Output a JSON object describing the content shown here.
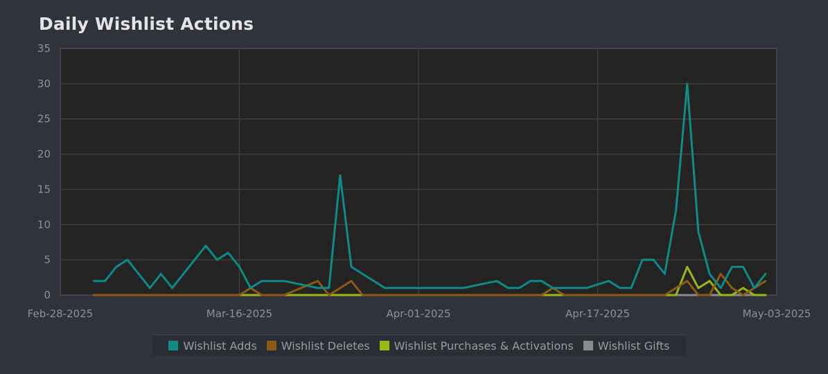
{
  "chart_data": {
    "type": "line",
    "title": "Daily Wishlist Actions",
    "xlabel": "",
    "ylabel": "",
    "ylim": [
      0,
      35
    ],
    "yticks": [
      0,
      5,
      10,
      15,
      20,
      25,
      30,
      35
    ],
    "xlim": [
      "2025-02-28",
      "2025-05-03"
    ],
    "xticks": [
      "Feb-28-2025",
      "Mar-16-2025",
      "Apr-01-2025",
      "Apr-17-2025",
      "May-03-2025"
    ],
    "grid": true,
    "legend_position": "bottom",
    "series": [
      {
        "name": "Wishlist Adds",
        "color": "#0e8a87",
        "points": [
          [
            "2025-03-03",
            2
          ],
          [
            "2025-03-04",
            2
          ],
          [
            "2025-03-05",
            4
          ],
          [
            "2025-03-06",
            5
          ],
          [
            "2025-03-08",
            1
          ],
          [
            "2025-03-09",
            3
          ],
          [
            "2025-03-10",
            1
          ],
          [
            "2025-03-13",
            7
          ],
          [
            "2025-03-14",
            5
          ],
          [
            "2025-03-15",
            6
          ],
          [
            "2025-03-16",
            4
          ],
          [
            "2025-03-17",
            1
          ],
          [
            "2025-03-18",
            2
          ],
          [
            "2025-03-20",
            2
          ],
          [
            "2025-03-23",
            1
          ],
          [
            "2025-03-24",
            1
          ],
          [
            "2025-03-25",
            17
          ],
          [
            "2025-03-26",
            4
          ],
          [
            "2025-03-29",
            1
          ],
          [
            "2025-04-02",
            1
          ],
          [
            "2025-04-05",
            1
          ],
          [
            "2025-04-08",
            2
          ],
          [
            "2025-04-09",
            1
          ],
          [
            "2025-04-10",
            1
          ],
          [
            "2025-04-11",
            2
          ],
          [
            "2025-04-12",
            2
          ],
          [
            "2025-04-13",
            1
          ],
          [
            "2025-04-16",
            1
          ],
          [
            "2025-04-18",
            2
          ],
          [
            "2025-04-19",
            1
          ],
          [
            "2025-04-20",
            1
          ],
          [
            "2025-04-21",
            5
          ],
          [
            "2025-04-22",
            5
          ],
          [
            "2025-04-23",
            3
          ],
          [
            "2025-04-24",
            12
          ],
          [
            "2025-04-25",
            30
          ],
          [
            "2025-04-26",
            9
          ],
          [
            "2025-04-27",
            3
          ],
          [
            "2025-04-28",
            1
          ],
          [
            "2025-04-29",
            4
          ],
          [
            "2025-04-30",
            4
          ],
          [
            "2025-05-01",
            1
          ],
          [
            "2025-05-02",
            3
          ]
        ]
      },
      {
        "name": "Wishlist Deletes",
        "color": "#8c5a12",
        "points": [
          [
            "2025-03-03",
            0
          ],
          [
            "2025-03-16",
            0
          ],
          [
            "2025-03-17",
            1
          ],
          [
            "2025-03-18",
            0
          ],
          [
            "2025-03-20",
            0
          ],
          [
            "2025-03-23",
            2
          ],
          [
            "2025-03-24",
            0
          ],
          [
            "2025-03-26",
            2
          ],
          [
            "2025-03-27",
            0
          ],
          [
            "2025-04-12",
            0
          ],
          [
            "2025-04-13",
            1
          ],
          [
            "2025-04-14",
            0
          ],
          [
            "2025-04-23",
            0
          ],
          [
            "2025-04-25",
            2
          ],
          [
            "2025-04-26",
            0
          ],
          [
            "2025-04-27",
            0
          ],
          [
            "2025-04-28",
            3
          ],
          [
            "2025-04-29",
            1
          ],
          [
            "2025-04-30",
            0
          ],
          [
            "2025-05-01",
            1
          ],
          [
            "2025-05-02",
            2
          ]
        ]
      },
      {
        "name": "Wishlist Purchases & Activations",
        "color": "#9ab812",
        "points": [
          [
            "2025-03-03",
            0
          ],
          [
            "2025-04-24",
            0
          ],
          [
            "2025-04-25",
            4
          ],
          [
            "2025-04-26",
            1
          ],
          [
            "2025-04-27",
            2
          ],
          [
            "2025-04-28",
            0
          ],
          [
            "2025-04-29",
            0
          ],
          [
            "2025-04-30",
            1
          ],
          [
            "2025-05-01",
            0
          ],
          [
            "2025-05-02",
            0
          ]
        ]
      },
      {
        "name": "Wishlist Gifts",
        "color": "#8a8a8a",
        "points": [
          [
            "2025-03-03",
            0
          ],
          [
            "2025-05-02",
            0
          ]
        ]
      }
    ]
  }
}
